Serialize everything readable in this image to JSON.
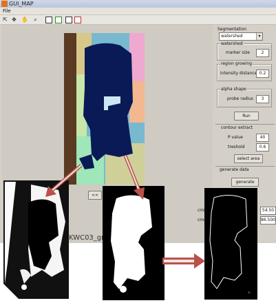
{
  "window": {
    "title": "GUI_MAP",
    "menu_file": "File"
  },
  "toolbar": {
    "icons": [
      "pointer-icon",
      "pan-icon",
      "hand-icon",
      "zoom-icon",
      "crop-icon",
      "fit-icon",
      "reset-icon"
    ]
  },
  "panel": {
    "segmentation_label": "Segmentation",
    "method_value": "watershed",
    "watershed": {
      "title": "watershed",
      "marker_label": "marker size",
      "marker_value": "2"
    },
    "region": {
      "title": "region growing",
      "intensity_label": "intensity distance",
      "intensity_value": "0.2"
    },
    "alpha": {
      "title": "alpha shape",
      "probe_label": "probe radius",
      "probe_value": "3"
    },
    "run_label": "Run",
    "contour": {
      "title": "contour extract",
      "p_label": "P value",
      "p_value": "40",
      "thr_label": "treshold",
      "thr_value": "0.6",
      "select_label": "select area"
    },
    "generate": {
      "title": "generate data",
      "button_label": "generate"
    }
  },
  "bottom": {
    "button_label": "<<",
    "cmin_label": "cmin",
    "cmax_label": "cmax",
    "cmin_value": "54.50",
    "cmax_value": "86.500",
    "file_text": "KWC03_grou"
  },
  "colors": {
    "arrow": "#b9514b",
    "blob": "#0a1a56",
    "accent": "#2c4a86"
  }
}
